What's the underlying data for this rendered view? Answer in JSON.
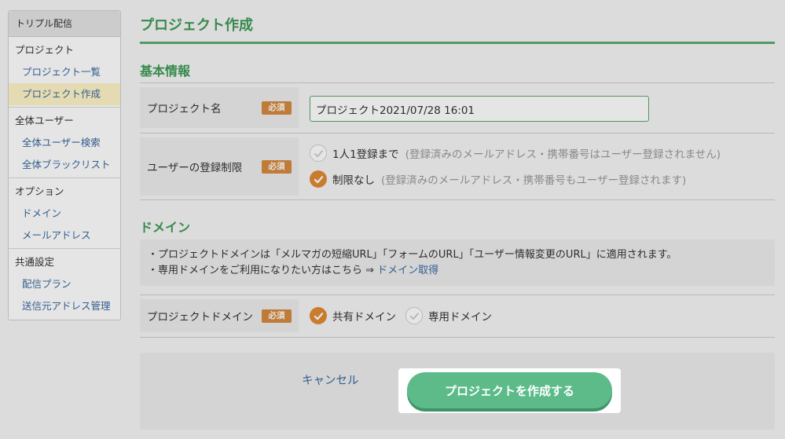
{
  "sidebar": {
    "header": "トリプル配信",
    "groups": [
      {
        "category": "プロジェクト",
        "items": [
          "プロジェクト一覧",
          "プロジェクト作成"
        ]
      },
      {
        "category": "全体ユーザー",
        "items": [
          "全体ユーザー検索",
          "全体ブラックリスト"
        ]
      },
      {
        "category": "オプション",
        "items": [
          "ドメイン",
          "メールアドレス"
        ]
      },
      {
        "category": "共通設定",
        "items": [
          "配信プラン",
          "送信元アドレス管理"
        ]
      }
    ],
    "active_item": "プロジェクト作成"
  },
  "page": {
    "title": "プロジェクト作成"
  },
  "basic_info": {
    "title": "基本情報",
    "project_name": {
      "label": "プロジェクト名",
      "badge": "必須",
      "value": "プロジェクト2021/07/28 16:01"
    },
    "registration_limit": {
      "label": "ユーザーの登録制限",
      "badge": "必須",
      "options": [
        {
          "label": "1人1登録まで",
          "note": "(登録済みのメールアドレス・携帯番号はユーザー登録されません)",
          "selected": false
        },
        {
          "label": "制限なし",
          "note": "(登録済みのメールアドレス・携帯番号もユーザー登録されます)",
          "selected": true
        }
      ]
    }
  },
  "domain": {
    "title": "ドメイン",
    "info_line1": "・プロジェクトドメインは「メルマガの短縮URL」「フォームのURL」「ユーザー情報変更のURL」に適用されます。",
    "info_line2_prefix": "・専用ドメインをご利用になりたい方はこちら ⇒ ",
    "info_line2_link": "ドメイン取得",
    "project_domain": {
      "label": "プロジェクトドメイン",
      "badge": "必須",
      "options": [
        {
          "label": "共有ドメイン",
          "selected": true
        },
        {
          "label": "専用ドメイン",
          "selected": false
        }
      ]
    }
  },
  "actions": {
    "cancel": "キャンセル",
    "submit": "プロジェクトを作成する"
  },
  "colors": {
    "accent_green": "#3e9a55",
    "badge_orange": "#d58a3e",
    "check_orange": "#e08a34",
    "button_green": "#5cbb88",
    "link_blue": "#3a6aa0"
  }
}
